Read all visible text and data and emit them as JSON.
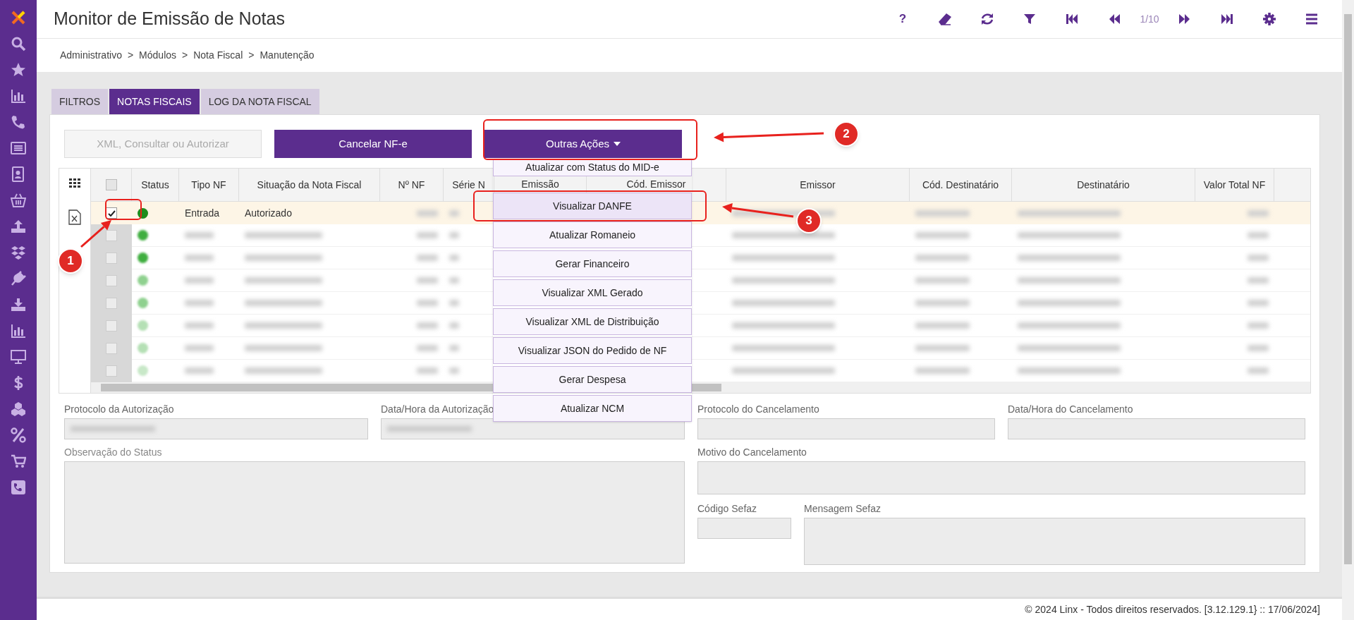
{
  "header": {
    "title": "Monitor de Emissão de Notas",
    "page_indicator": "1/10",
    "help_label": "?"
  },
  "breadcrumb": [
    "Administrativo",
    ">",
    "Módulos",
    ">",
    "Nota Fiscal",
    ">",
    "Manutenção"
  ],
  "tabs": [
    {
      "label": "FILTROS",
      "selected": false
    },
    {
      "label": "NOTAS FISCAIS",
      "selected": true
    },
    {
      "label": "LOG DA NOTA FISCAL",
      "selected": false
    }
  ],
  "actions": [
    {
      "label": "XML, Consultar ou Autorizar",
      "disabled": true
    },
    {
      "label": "Cancelar NF-e",
      "disabled": false
    },
    {
      "label": "Outras Ações",
      "disabled": false
    }
  ],
  "menu": [
    {
      "label": "Atualizar com Status do MID-e",
      "selected": false
    },
    {
      "label": "Visualizar DANFE",
      "selected": true
    },
    {
      "label": "Atualizar Romaneio",
      "selected": false
    },
    {
      "label": "Gerar Financeiro",
      "selected": false
    },
    {
      "label": "Visualizar XML Gerado",
      "selected": false
    },
    {
      "label": "Visualizar XML de Distribuição",
      "selected": false
    },
    {
      "label": "Visualizar JSON do Pedido de NF",
      "selected": false
    },
    {
      "label": "Gerar Despesa",
      "selected": false
    },
    {
      "label": "Atualizar NCM",
      "selected": false
    }
  ],
  "table": {
    "columns": [
      "Status",
      "Tipo NF",
      "Situação da Nota Fiscal",
      "Nº NF",
      "Série N",
      "Emissão",
      "Cód. Emissor",
      "Emissor",
      "Cód. Destinatário",
      "Destinatário",
      "Valor Total NF"
    ],
    "select_all_checked": false,
    "rows": [
      {
        "kind": "readable",
        "selected": true,
        "checked": true,
        "color": "#1e8c1e",
        "tipo_nf": "Entrada",
        "situacao": "Autorizado"
      },
      {
        "kind": "blurred",
        "selected": false,
        "checked": false,
        "color": "#3fae3f"
      },
      {
        "kind": "blurred",
        "selected": false,
        "checked": false,
        "color": "#3fae3f"
      },
      {
        "kind": "blurred",
        "selected": false,
        "checked": false,
        "color": "#8fd18f"
      },
      {
        "kind": "blurred",
        "selected": false,
        "checked": false,
        "color": "#8fd18f"
      },
      {
        "kind": "blurred",
        "selected": false,
        "checked": false,
        "color": "#b5e0b5"
      },
      {
        "kind": "blurred",
        "selected": false,
        "checked": false,
        "color": "#b5e0b5"
      },
      {
        "kind": "blurred",
        "selected": false,
        "checked": false,
        "color": "#c8e8c8"
      }
    ]
  },
  "form": {
    "left": [
      {
        "label": "Protocolo da Autorização"
      },
      {
        "label": "Data/Hora da Autorização"
      }
    ],
    "observacao": "Observação do Status",
    "right": [
      {
        "label": "Protocolo do Cancelamento"
      },
      {
        "label": "Data/Hora do Cancelamento"
      }
    ],
    "motivo": "Motivo do Cancelamento",
    "codigo": "Código Sefaz",
    "mensagem": "Mensagem Sefaz"
  },
  "footer": "© 2024 Linx - Todos direitos reservados. [3.12.129.1} :: 17/06/2024]",
  "annotations": [
    "1",
    "2",
    "3"
  ]
}
